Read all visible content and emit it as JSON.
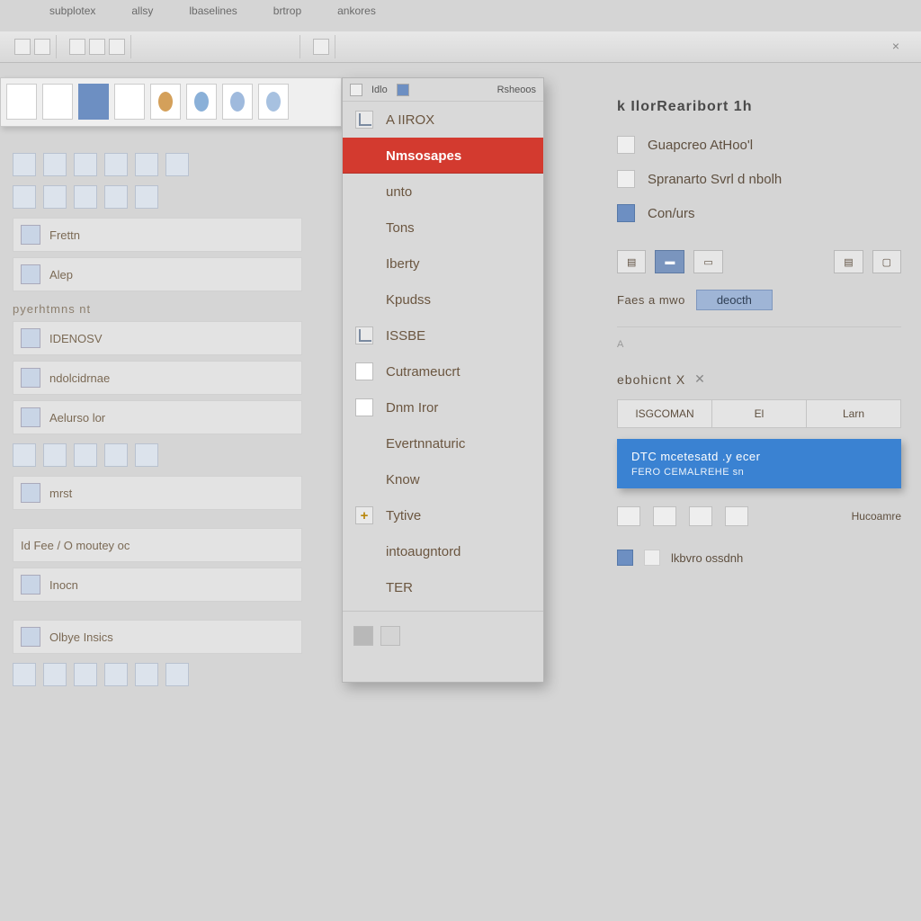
{
  "menubar": [
    "subplotex",
    "allsy",
    "lbaselines",
    "brtrop",
    "ankores"
  ],
  "menu_panel": {
    "header": [
      "Idlo",
      "",
      "Rsheoos"
    ],
    "items": [
      {
        "icon": "axis",
        "label": "A IIROX"
      },
      {
        "icon": "none",
        "label": "Nmsosapes",
        "highlight": true
      },
      {
        "icon": "none",
        "label": "unto"
      },
      {
        "icon": "none",
        "label": "Tons"
      },
      {
        "icon": "none",
        "label": "Iberty"
      },
      {
        "icon": "none",
        "label": "Kpudss"
      },
      {
        "icon": "axis",
        "label": "ISSBE"
      },
      {
        "icon": "page",
        "label": "Cutrameucrt"
      },
      {
        "icon": "page",
        "label": "Dnm Iror"
      },
      {
        "icon": "none",
        "label": "Evertnnaturic"
      },
      {
        "icon": "none",
        "label": "Know"
      },
      {
        "icon": "plus",
        "label": "Tytive"
      },
      {
        "icon": "none",
        "label": "intoaugntord"
      },
      {
        "icon": "none",
        "label": "TER"
      }
    ]
  },
  "catalog": {
    "rows": [
      "Frettn",
      "Alep",
      "pyerhtmns  nt",
      "IDENOSV",
      "ndolcidrnae",
      "Aelurso lor",
      "mrst",
      "Id Fee / O   moutey oc",
      "Inocn",
      "Olbye Insics"
    ]
  },
  "inspector": {
    "title": "k IlorRearibort  1h",
    "rows": [
      {
        "icon": "",
        "label": "Guapcreo AtHoo'l"
      },
      {
        "icon": "",
        "label": "Spranarto Svrl   d  nbolh"
      },
      {
        "icon": "blue",
        "label": "Con/urs"
      }
    ],
    "pair": {
      "label": "Faes a mwo",
      "pill": "deocth"
    },
    "sub": "ebohicnt  X",
    "segments": [
      "ISGCOMAN",
      "El",
      "Larn"
    ],
    "tooltip": {
      "line1": "DTC  mcetesatd .y  ecer",
      "line2": "FERO  CEMALREHE  sn"
    },
    "swlabel": "Hucoamre",
    "foot": "lkbvro ossdnh"
  }
}
